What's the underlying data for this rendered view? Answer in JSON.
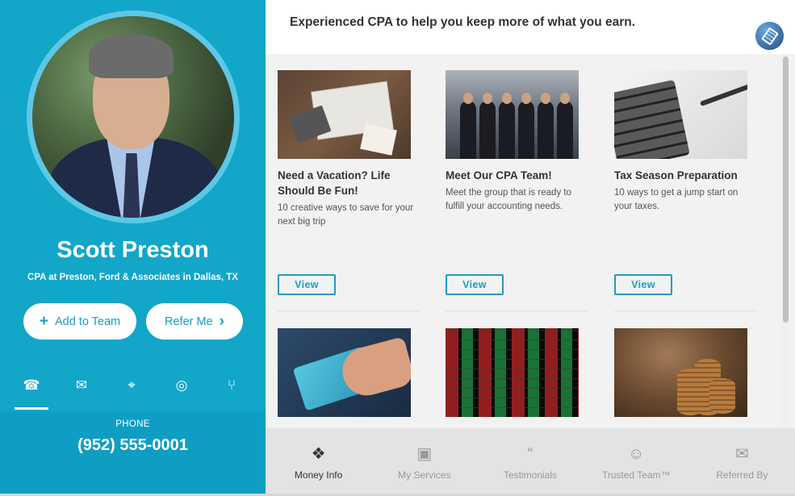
{
  "profile": {
    "name": "Scott Preston",
    "title": "CPA at Preston, Ford & Associates in Dallas, TX",
    "add_button": {
      "icon": "plus-icon",
      "label": "Add to Team"
    },
    "refer_button": {
      "icon": "chevron-right-icon",
      "label": "Refer Me"
    },
    "contact_tabs": [
      {
        "name": "phone",
        "icon": "phone-icon",
        "glyph": "☎",
        "active": true
      },
      {
        "name": "email",
        "icon": "envelope-icon",
        "glyph": "✉",
        "active": false
      },
      {
        "name": "location",
        "icon": "map-pin-icon",
        "glyph": "⌖",
        "active": false
      },
      {
        "name": "website",
        "icon": "globe-icon",
        "glyph": "◎",
        "active": false
      },
      {
        "name": "share",
        "icon": "share-icon",
        "glyph": "⑂",
        "active": false
      }
    ],
    "contact_label": "PHONE",
    "contact_value": "(952) 555-0001"
  },
  "header": {
    "tagline": "Experienced CPA to help you keep more of what you earn.",
    "tool_icon": "calculator-icon"
  },
  "cards": [
    {
      "title": "Need a Vacation? Life Should Be Fun!",
      "description": "10 creative ways to save for your next big trip",
      "button": "View",
      "image": "travel-planning-image"
    },
    {
      "title": "Meet Our CPA Team!",
      "description": "Meet the group that is ready to fulfill your accounting needs.",
      "button": "View",
      "image": "team-photo-image"
    },
    {
      "title": "Tax Season Preparation",
      "description": "10 ways to get a jump start on your taxes.",
      "button": "View",
      "image": "calculator-pen-image"
    },
    {
      "title": "",
      "description": "",
      "button": "",
      "image": "credit-card-image"
    },
    {
      "title": "",
      "description": "",
      "button": "",
      "image": "stock-board-image"
    },
    {
      "title": "",
      "description": "",
      "button": "",
      "image": "coin-stacks-image"
    }
  ],
  "bottom_nav": [
    {
      "label": "Money Info",
      "icon": "tags-icon",
      "glyph": "❖",
      "active": true
    },
    {
      "label": "My Services",
      "icon": "briefcase-icon",
      "glyph": "▣",
      "active": false
    },
    {
      "label": "Testimonials",
      "icon": "quote-icon",
      "glyph": "“",
      "active": false
    },
    {
      "label": "Trusted Team™",
      "icon": "users-icon",
      "glyph": "☺",
      "active": false
    },
    {
      "label": "Referred By",
      "icon": "chat-icon",
      "glyph": "✉",
      "active": false
    }
  ],
  "colors": {
    "brand": "#12a6c9",
    "accent": "#1e9dc4"
  }
}
